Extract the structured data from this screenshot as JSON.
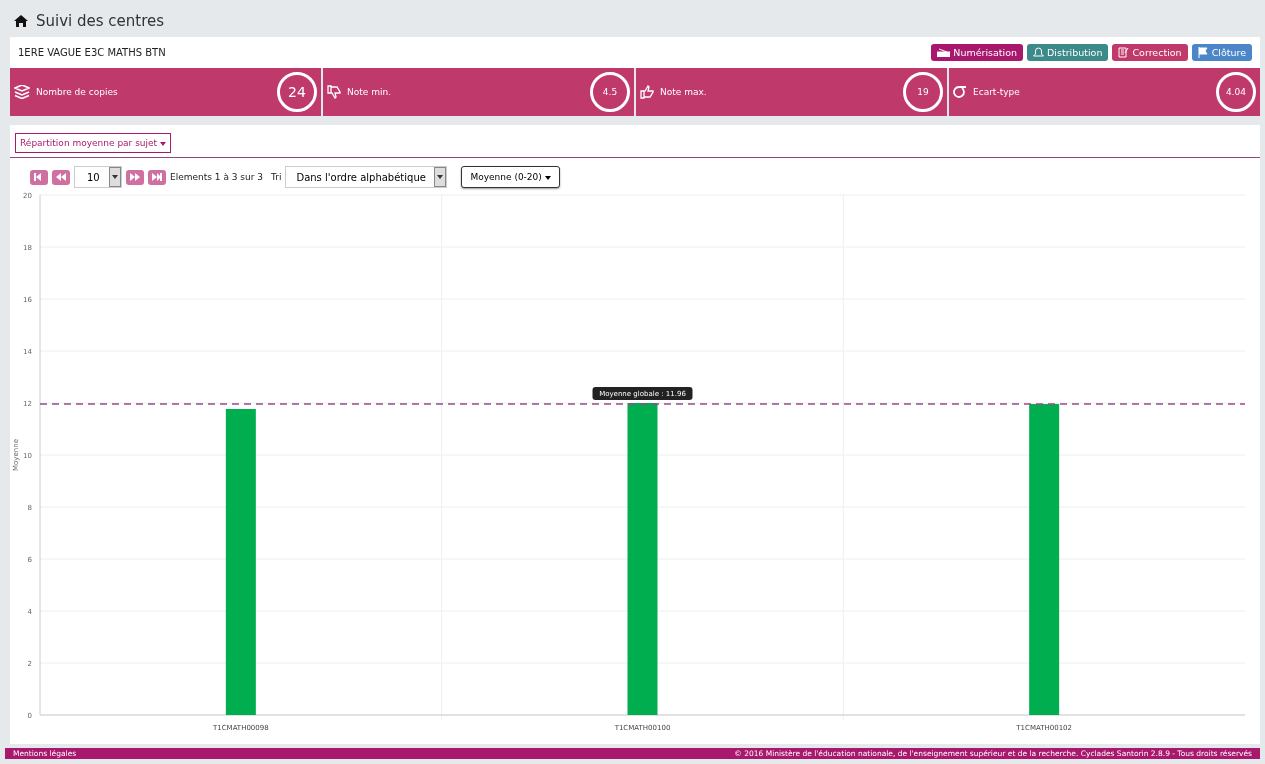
{
  "header": {
    "title": "Suivi des centres"
  },
  "exam": {
    "name": "1ERE VAGUE E3C MATHS BTN"
  },
  "actions": [
    {
      "label": "Numérisation",
      "kind": "scan",
      "color": "#a8196e"
    },
    {
      "label": "Distribution",
      "kind": "distribution",
      "color": "#3d8a8a"
    },
    {
      "label": "Correction",
      "kind": "correction",
      "color": "#c0396b"
    },
    {
      "label": "Clôture",
      "kind": "closing",
      "color": "#4a86c8"
    }
  ],
  "stats": [
    {
      "label": "Nombre de copies",
      "value": "24",
      "kind": "copies"
    },
    {
      "label": "Note min.",
      "value": "4.5",
      "kind": "min"
    },
    {
      "label": "Note max.",
      "value": "19",
      "kind": "max"
    },
    {
      "label": "Ecart-type",
      "value": "4.04",
      "kind": "sigma"
    }
  ],
  "view_menu": {
    "label": "Répartition moyenne par sujet"
  },
  "pager": {
    "page_size": "10",
    "range": "Elements 1 à 3 sur 3",
    "sort_label": "Tri",
    "sort": "Dans l'ordre alphabétique",
    "measure": "Moyenne (0-20)"
  },
  "chart": {
    "chart_data": {
      "type": "bar",
      "ylabel": "Moyenne",
      "categories": [
        "T1CMATH00098",
        "T1CMATH00100",
        "T1CMATH00102"
      ],
      "series": [
        {
          "color": "#00ad4f",
          "values": [
            11.77,
            12.0,
            11.96
          ]
        }
      ],
      "ylim": [
        0,
        20
      ],
      "yticks": [
        0,
        2,
        4,
        6,
        8,
        10,
        12,
        14,
        16,
        18,
        20
      ],
      "grid": true,
      "ref_lines": [
        {
          "axis": "y",
          "value": 11.96,
          "color": "#9a4a8a",
          "label": "Moyenne globale : 11.96"
        }
      ]
    }
  },
  "footer": {
    "left": "Mentions légales",
    "right": "© 2016 Ministère de l'éducation nationale, de l'enseignement supérieur et de la recherche. Cyclades Santorin 2.8.9 - Tous droits réservés"
  }
}
